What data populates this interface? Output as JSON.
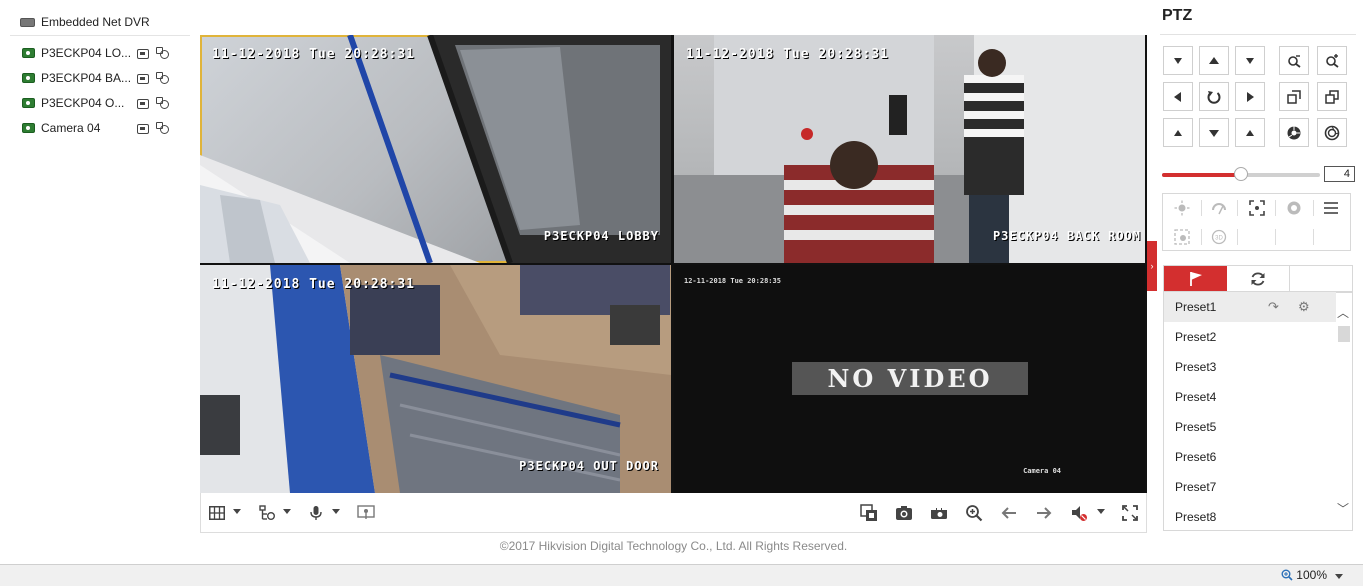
{
  "tree": {
    "root_label": "Embedded Net DVR",
    "cameras": [
      {
        "label": "P3ECKP04 LO..."
      },
      {
        "label": "P3ECKP04 BA..."
      },
      {
        "label": "P3ECKP04 O..."
      },
      {
        "label": "Camera 04"
      }
    ]
  },
  "video": {
    "tiles": [
      {
        "timestamp": "11-12-2018 Tue 20:28:31",
        "name": "P3ECKP04 LOBBY",
        "selected": true
      },
      {
        "timestamp": "11-12-2018 Tue 20:28:31",
        "name": "P3ECKP04 BACK ROOM",
        "selected": false
      },
      {
        "timestamp": "11-12-2018 Tue 20:28:31",
        "name": "P3ECKP04 OUT DOOR",
        "selected": false
      },
      {
        "timestamp": "12-11-2018 Tue 20:28:35",
        "name": "Camera 04",
        "no_video_text": "NO VIDEO",
        "selected": false
      }
    ]
  },
  "toolbar": {
    "left": [
      "window-layout",
      "stream-type",
      "microphone",
      "video-wall"
    ],
    "right": [
      "stop-all",
      "capture",
      "record",
      "digital-zoom",
      "prev-page",
      "next-page",
      "volume-mute",
      "fullscreen"
    ]
  },
  "footer": {
    "copyright": "©2017 Hikvision Digital Technology Co., Ltd. All Rights Reserved."
  },
  "ptz": {
    "title": "PTZ",
    "speed_value": "4",
    "speed_fraction": 0.5,
    "tabs": [
      "preset",
      "patrol",
      "pattern"
    ],
    "active_tab": "preset",
    "presets": [
      "Preset1",
      "Preset2",
      "Preset3",
      "Preset4",
      "Preset5",
      "Preset6",
      "Preset7",
      "Preset8"
    ]
  },
  "statusbar": {
    "zoom": "100%"
  },
  "colors": {
    "accent": "#d32f2f",
    "selected_border": "#e0b43a"
  }
}
